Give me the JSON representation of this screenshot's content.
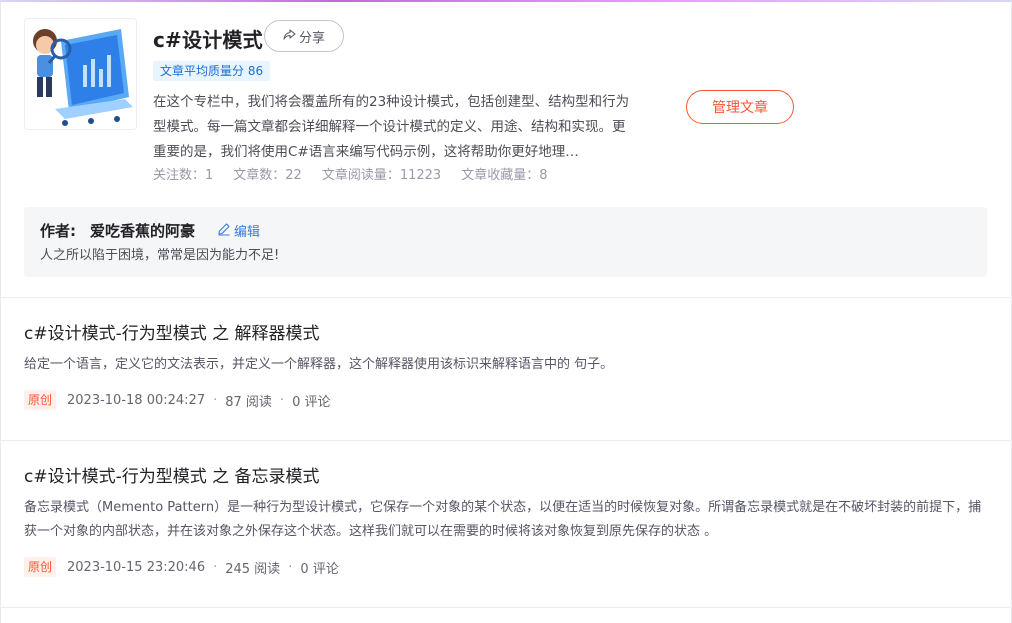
{
  "column": {
    "title": "c#设计模式",
    "share_label": "分享",
    "quality": "文章平均质量分 86",
    "description": "在这个专栏中，我们将会覆盖所有的23种设计模式，包括创建型、结构型和行为型模式。每一篇文章都会详细解释一个设计模式的定义、用途、结构和实现。更重要的是，我们将使用C#语言来编写代码示例，这将帮助你更好地理…",
    "stats": {
      "followers": "关注数：1",
      "articles": "文章数：22",
      "reads": "文章阅读量：11223",
      "favorites": "文章收藏量：8"
    },
    "manage_label": "管理文章"
  },
  "author": {
    "label": "作者:",
    "name": "爱吃香蕉的阿豪",
    "edit_label": "编辑",
    "motto": "人之所以陷于困境，常常是因为能力不足!"
  },
  "articles": [
    {
      "title": "c#设计模式-行为型模式 之 解释器模式",
      "summary": "给定一个语言，定义它的文法表示，并定义一个解释器，这个解释器使用该标识来解释语言中的 句子。",
      "tag": "原创",
      "date": "2023-10-18 00:24:27",
      "reads": "87 阅读",
      "comments": "0 评论"
    },
    {
      "title": "c#设计模式-行为型模式 之 备忘录模式",
      "summary": "备忘录模式（Memento Pattern）是一种行为型设计模式，它保存一个对象的某个状态，以便在适当的时候恢复对象。所谓备忘录模式就是在不破坏封装的前提下，捕获一个对象的内部状态，并在该对象之外保存这个状态。这样我们就可以在需要的时候将该对象恢复到原先保存的状态 。",
      "tag": "原创",
      "date": "2023-10-15 23:20:46",
      "reads": "245 阅读",
      "comments": "0 评论"
    }
  ],
  "colors": {
    "accent": "#fc5531",
    "link": "#3a7bd5",
    "quality_bg": "#e8f4ff"
  },
  "icons": {
    "share": "share-icon",
    "edit": "pencil-icon"
  }
}
